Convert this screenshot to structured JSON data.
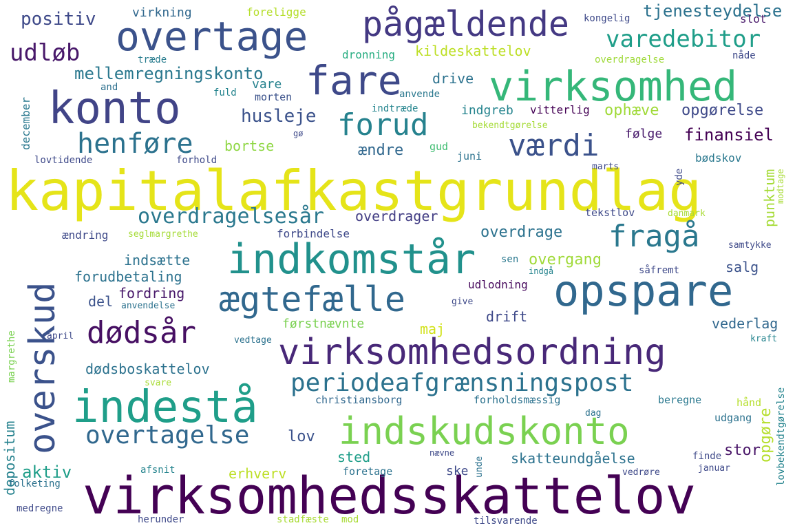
{
  "words": [
    {
      "text": "kapitalafkastgrundlag",
      "color": "#e5e419"
    },
    {
      "text": "virksomhedsskattelov",
      "color": "#440154"
    },
    {
      "text": "opspare",
      "color": "#31688e"
    },
    {
      "text": "virksomhed",
      "color": "#35b779"
    },
    {
      "text": "indkomstår",
      "color": "#21918c"
    },
    {
      "text": "overtage",
      "color": "#3b528b"
    },
    {
      "text": "konto",
      "color": "#414487"
    },
    {
      "text": "overskud",
      "color": "#3b528b"
    },
    {
      "text": "indestå",
      "color": "#1f9e89"
    },
    {
      "text": "indskudskonto",
      "color": "#7ad151"
    },
    {
      "text": "virksomhedsordning",
      "color": "#482878"
    },
    {
      "text": "pågældende",
      "color": "#443983"
    },
    {
      "text": "ægtefælle",
      "color": "#31688e"
    },
    {
      "text": "fare",
      "color": "#3e4989"
    },
    {
      "text": "periodeafgrænsningspost",
      "color": "#2c728e"
    },
    {
      "text": "dødsår",
      "color": "#471063"
    },
    {
      "text": "fragå",
      "color": "#2a788e"
    },
    {
      "text": "værdi",
      "color": "#3b528b"
    },
    {
      "text": "forud",
      "color": "#26828e"
    },
    {
      "text": "henføre",
      "color": "#2c728e"
    },
    {
      "text": "overtagelse",
      "color": "#31688e"
    },
    {
      "text": "varedebitor",
      "color": "#1f9e89"
    },
    {
      "text": "udløb",
      "color": "#48186a"
    },
    {
      "text": "overdragelsesår",
      "color": "#2a788e"
    },
    {
      "text": "tjenesteydelse",
      "color": "#2c728e"
    },
    {
      "text": "mellemregningskonto",
      "color": "#2a788e"
    },
    {
      "text": "positiv",
      "color": "#3e4989"
    },
    {
      "text": "virkning",
      "color": "#31688e"
    },
    {
      "text": "foreligge",
      "color": "#b5de2b"
    },
    {
      "text": "kongelig",
      "color": "#3e4989"
    },
    {
      "text": "slot",
      "color": "#48186a"
    },
    {
      "text": "kildeskattelov",
      "color": "#bddf26"
    },
    {
      "text": "dronning",
      "color": "#27ad81"
    },
    {
      "text": "træde",
      "color": "#287c8e"
    },
    {
      "text": "overdragelse",
      "color": "#9fda3a"
    },
    {
      "text": "nåde",
      "color": "#3e4989"
    },
    {
      "text": "december",
      "color": "#2a788e"
    },
    {
      "text": "and",
      "color": "#2d708e"
    },
    {
      "text": "vare",
      "color": "#26828e"
    },
    {
      "text": "fuld",
      "color": "#25848e"
    },
    {
      "text": "morten",
      "color": "#3b528b"
    },
    {
      "text": "anvende",
      "color": "#2a788e"
    },
    {
      "text": "drive",
      "color": "#2c728e"
    },
    {
      "text": "indtræde",
      "color": "#25858e"
    },
    {
      "text": "indgreb",
      "color": "#25848e"
    },
    {
      "text": "vitterlig",
      "color": "#440154"
    },
    {
      "text": "ophæve",
      "color": "#a0da39"
    },
    {
      "text": "opgørelse",
      "color": "#3e4989"
    },
    {
      "text": "husleje",
      "color": "#3b528b"
    },
    {
      "text": "bekendtgørelse",
      "color": "#a5db36"
    },
    {
      "text": "følge",
      "color": "#481a6c"
    },
    {
      "text": "finansiel",
      "color": "#440154"
    },
    {
      "text": "gø",
      "color": "#3e4989"
    },
    {
      "text": "bortse",
      "color": "#8fd744"
    },
    {
      "text": "ændre",
      "color": "#31688e"
    },
    {
      "text": "gud",
      "color": "#40bd72"
    },
    {
      "text": "juni",
      "color": "#2c728e"
    },
    {
      "text": "lovtidende",
      "color": "#3e4989"
    },
    {
      "text": "forhold",
      "color": "#3e4989"
    },
    {
      "text": "bødskov",
      "color": "#2a788e"
    },
    {
      "text": "punktum",
      "color": "#a5db36"
    },
    {
      "text": "marts",
      "color": "#3e4989"
    },
    {
      "text": "yde",
      "color": "#3e4989"
    },
    {
      "text": "modtage",
      "color": "#a8db34"
    },
    {
      "text": "tekstlov",
      "color": "#3e4989"
    },
    {
      "text": "danmark",
      "color": "#a8db34"
    },
    {
      "text": "overdrager",
      "color": "#433e85"
    },
    {
      "text": "overdrage",
      "color": "#2c728e"
    },
    {
      "text": "forbindelse",
      "color": "#3e4989"
    },
    {
      "text": "ændring",
      "color": "#3e4989"
    },
    {
      "text": "seglmargrethe",
      "color": "#a5db36"
    },
    {
      "text": "samtykke",
      "color": "#3e4989"
    },
    {
      "text": "indsætte",
      "color": "#2c728e"
    },
    {
      "text": "sen",
      "color": "#2a788e"
    },
    {
      "text": "overgang",
      "color": "#a0da39"
    },
    {
      "text": "salg",
      "color": "#3b528b"
    },
    {
      "text": "forudbetaling",
      "color": "#2c728e"
    },
    {
      "text": "indgå",
      "color": "#25848e"
    },
    {
      "text": "såfremt",
      "color": "#3e4989"
    },
    {
      "text": "fordring",
      "color": "#48186a"
    },
    {
      "text": "udlodning",
      "color": "#46085c"
    },
    {
      "text": "del",
      "color": "#3b528b"
    },
    {
      "text": "anvendelse",
      "color": "#2c728e"
    },
    {
      "text": "give",
      "color": "#3e4989"
    },
    {
      "text": "drift",
      "color": "#3e4989"
    },
    {
      "text": "vederlag",
      "color": "#31688e"
    },
    {
      "text": "førstnævnte",
      "color": "#7ad151"
    },
    {
      "text": "maj",
      "color": "#d2e21b"
    },
    {
      "text": "april",
      "color": "#3e4989"
    },
    {
      "text": "vedtage",
      "color": "#2c728e"
    },
    {
      "text": "kraft",
      "color": "#25848e"
    },
    {
      "text": "dødsboskattelov",
      "color": "#2c728e"
    },
    {
      "text": "margrethe",
      "color": "#7ad151"
    },
    {
      "text": "lovbekendtgørelse",
      "color": "#25848e"
    },
    {
      "text": "svare",
      "color": "#a8db34"
    },
    {
      "text": "christiansborg",
      "color": "#31688e"
    },
    {
      "text": "forholdsmæssig",
      "color": "#2c728e"
    },
    {
      "text": "beregne",
      "color": "#2a788e"
    },
    {
      "text": "hånd",
      "color": "#b5de2b"
    },
    {
      "text": "dag",
      "color": "#2c728e"
    },
    {
      "text": "depositum",
      "color": "#26828e"
    },
    {
      "text": "udgang",
      "color": "#2c728e"
    },
    {
      "text": "opgøre",
      "color": "#b5de2b"
    },
    {
      "text": "lov",
      "color": "#3b528b"
    },
    {
      "text": "aktiv",
      "color": "#1f9e89"
    },
    {
      "text": "sted",
      "color": "#1f9e89"
    },
    {
      "text": "stor",
      "color": "#481467"
    },
    {
      "text": "skatteundgåelse",
      "color": "#2c728e"
    },
    {
      "text": "nævne",
      "color": "#3e4989"
    },
    {
      "text": "finde",
      "color": "#3e4989"
    },
    {
      "text": "erhverv",
      "color": "#bddf26"
    },
    {
      "text": "ske",
      "color": "#3e4989"
    },
    {
      "text": "unde",
      "color": "#2c728e"
    },
    {
      "text": "afsnit",
      "color": "#25848e"
    },
    {
      "text": "foretage",
      "color": "#2c728e"
    },
    {
      "text": "januar",
      "color": "#3e4989"
    },
    {
      "text": "vedrøre",
      "color": "#3e4989"
    },
    {
      "text": "folketing",
      "color": "#2c728e"
    },
    {
      "text": "medregne",
      "color": "#3e4989"
    },
    {
      "text": "herunder",
      "color": "#3e4989"
    },
    {
      "text": "stadfæste",
      "color": "#a8db34"
    },
    {
      "text": "mod",
      "color": "#a8db34"
    },
    {
      "text": "tilsvarende",
      "color": "#3e4989"
    }
  ]
}
